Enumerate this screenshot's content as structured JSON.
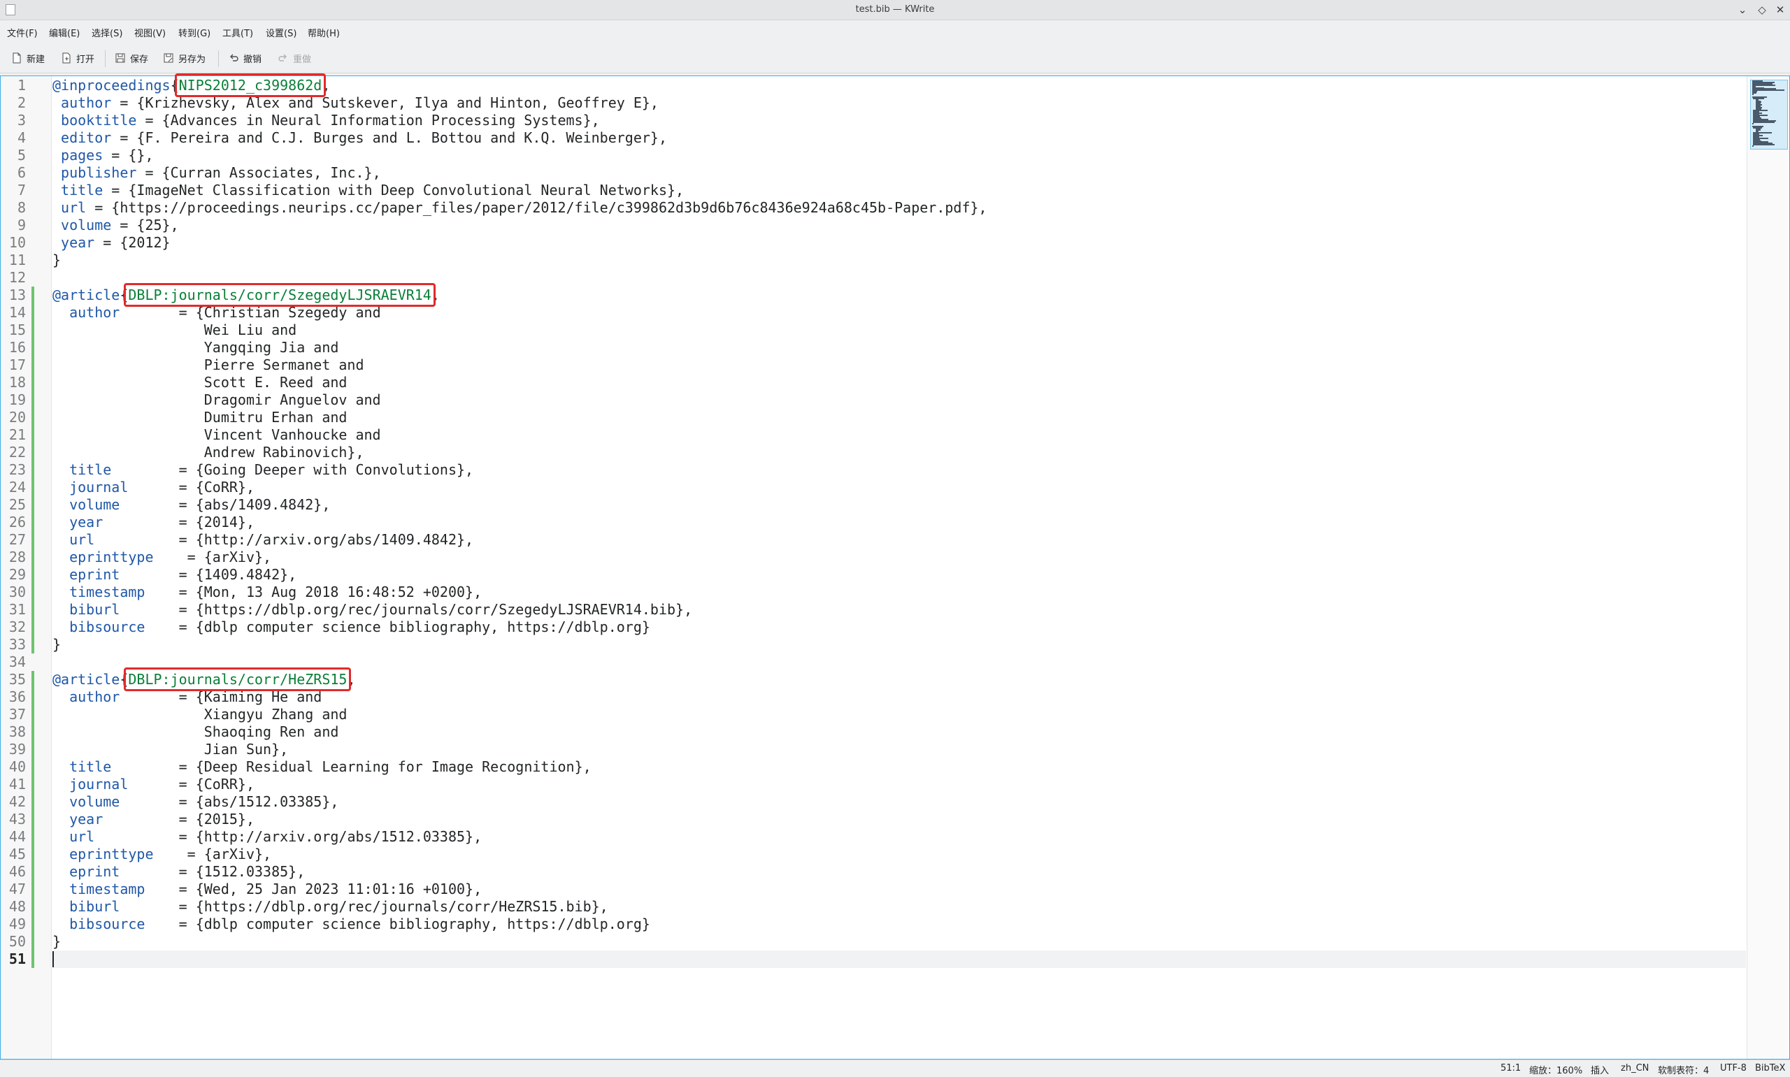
{
  "window": {
    "title": "test.bib — KWrite",
    "controls": {
      "minimize": "⌄",
      "maximize": "◇",
      "close": "✕"
    }
  },
  "menu": [
    "文件(F)",
    "编辑(E)",
    "选择(S)",
    "视图(V)",
    "转到(G)",
    "工具(T)",
    "设置(S)",
    "帮助(H)"
  ],
  "toolbar": {
    "new": "新建",
    "open": "打开",
    "save": "保存",
    "save_as": "另存为",
    "undo": "撤销",
    "redo": "重做"
  },
  "editor": {
    "line_numbers": [
      "1",
      "2",
      "3",
      "4",
      "5",
      "6",
      "7",
      "8",
      "9",
      "10",
      "11",
      "12",
      "13",
      "14",
      "15",
      "16",
      "17",
      "18",
      "19",
      "20",
      "21",
      "22",
      "23",
      "24",
      "25",
      "26",
      "27",
      "28",
      "29",
      "30",
      "31",
      "32",
      "33",
      "34",
      "35",
      "36",
      "37",
      "38",
      "39",
      "40",
      "41",
      "42",
      "43",
      "44",
      "45",
      "46",
      "47",
      "48",
      "49",
      "50",
      "51"
    ],
    "current_line": 51,
    "highlighted_keys": [
      "NIPS2012_c399862d",
      "DBLP:journals/corr/SzegedyLJSRAEVR14",
      "DBLP:journals/corr/HeZRS15"
    ],
    "lines": [
      "@inproceedings{NIPS2012_c399862d,",
      " author = {Krizhevsky, Alex and Sutskever, Ilya and Hinton, Geoffrey E},",
      " booktitle = {Advances in Neural Information Processing Systems},",
      " editor = {F. Pereira and C.J. Burges and L. Bottou and K.Q. Weinberger},",
      " pages = {},",
      " publisher = {Curran Associates, Inc.},",
      " title = {ImageNet Classification with Deep Convolutional Neural Networks},",
      " url = {https://proceedings.neurips.cc/paper_files/paper/2012/file/c399862d3b9d6b76c8436e924a68c45b-Paper.pdf},",
      " volume = {25},",
      " year = {2012}",
      "}",
      "",
      "@article{DBLP:journals/corr/SzegedyLJSRAEVR14,",
      "  author       = {Christian Szegedy and",
      "                  Wei Liu and",
      "                  Yangqing Jia and",
      "                  Pierre Sermanet and",
      "                  Scott E. Reed and",
      "                  Dragomir Anguelov and",
      "                  Dumitru Erhan and",
      "                  Vincent Vanhoucke and",
      "                  Andrew Rabinovich},",
      "  title        = {Going Deeper with Convolutions},",
      "  journal      = {CoRR},",
      "  volume       = {abs/1409.4842},",
      "  year         = {2014},",
      "  url          = {http://arxiv.org/abs/1409.4842},",
      "  eprinttype    = {arXiv},",
      "  eprint       = {1409.4842},",
      "  timestamp    = {Mon, 13 Aug 2018 16:48:52 +0200},",
      "  biburl       = {https://dblp.org/rec/journals/corr/SzegedyLJSRAEVR14.bib},",
      "  bibsource    = {dblp computer science bibliography, https://dblp.org}",
      "}",
      "",
      "@article{DBLP:journals/corr/HeZRS15,",
      "  author       = {Kaiming He and",
      "                  Xiangyu Zhang and",
      "                  Shaoqing Ren and",
      "                  Jian Sun},",
      "  title        = {Deep Residual Learning for Image Recognition},",
      "  journal      = {CoRR},",
      "  volume       = {abs/1512.03385},",
      "  year         = {2015},",
      "  url          = {http://arxiv.org/abs/1512.03385},",
      "  eprinttype    = {arXiv},",
      "  eprint       = {1512.03385},",
      "  timestamp    = {Wed, 25 Jan 2023 11:01:16 +0100},",
      "  biburl       = {https://dblp.org/rec/journals/corr/HeZRS15.bib},",
      "  bibsource    = {dblp computer science bibliography, https://dblp.org}",
      "}",
      ""
    ]
  },
  "status": {
    "cursor": "51:1",
    "zoom": "缩放：160%",
    "mode": "插入",
    "dictionary": "zh_CN",
    "indent": "软制表符：4",
    "encoding": "UTF-8",
    "syntax": "BibTeX"
  },
  "colors": {
    "accent": "#3daee9",
    "keyword": "#1f58a8",
    "entry_key": "#0a7f37",
    "highlight_box": "#e02b2b",
    "modified_marker": "#6fc36f"
  }
}
